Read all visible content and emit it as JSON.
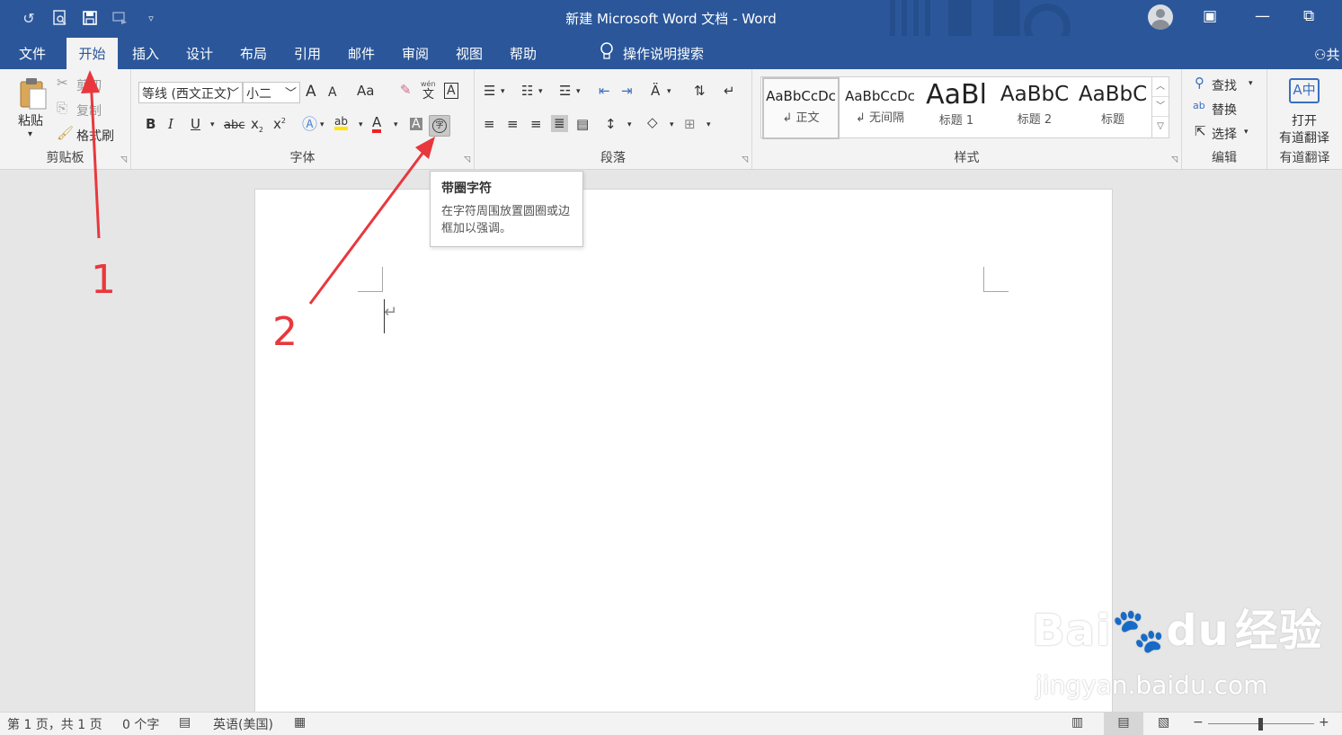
{
  "window": {
    "title": "新建 Microsoft Word 文档  -  Word"
  },
  "quick_access": {
    "icons": [
      "undo-icon",
      "print-preview-icon",
      "save-icon",
      "redo-icon",
      "customize-icon"
    ]
  },
  "tabs": [
    "文件",
    "开始",
    "插入",
    "设计",
    "布局",
    "引用",
    "邮件",
    "审阅",
    "视图",
    "帮助"
  ],
  "active_tab": "开始",
  "tell_me": "操作说明搜索",
  "share_label": "共",
  "clipboard": {
    "paste": "粘贴",
    "cut": "剪切",
    "copy": "复制",
    "format_painter": "格式刷",
    "label": "剪贴板"
  },
  "font": {
    "name": "等线 (西文正文)",
    "size": "小二",
    "label": "字体",
    "grow": "A",
    "shrink": "A",
    "case": "Aa",
    "bold": "B",
    "italic": "I",
    "underline": "U",
    "strike": "abc",
    "sub": "x",
    "sup": "x",
    "phonetic": "wén",
    "wen_char": "文",
    "border_char": "A",
    "font_color_char": "A",
    "shading_char": "A",
    "enclose_char": "字"
  },
  "paragraph": {
    "label": "段落"
  },
  "styles": {
    "label": "样式",
    "items": [
      {
        "preview": "AaBbCcDc",
        "name": "↲ 正文"
      },
      {
        "preview": "AaBbCcDc",
        "name": "↲ 无间隔"
      },
      {
        "preview": "AaBl",
        "name": "标题 1"
      },
      {
        "preview": "AaBbC",
        "name": "标题 2"
      },
      {
        "preview": "AaBbC",
        "name": "标题"
      }
    ]
  },
  "editing": {
    "find": "查找",
    "replace": "替换",
    "select": "选择",
    "label": "编辑"
  },
  "youdao": {
    "open": "打开",
    "translate": "有道翻译",
    "label": "有道翻译"
  },
  "tooltip": {
    "title": "带圈字符",
    "desc": "在字符周围放置圆圈或边框加以强调。"
  },
  "annotations": {
    "one": "1",
    "two": "2",
    "color": "#e8383d"
  },
  "status": {
    "page": "第 1 页，共 1 页",
    "words": "0 个字",
    "language": "英语(美国)"
  },
  "watermark": {
    "brand": "Bai",
    "brand2": "du",
    "jingyan": "经验",
    "url": "jingyan.baidu.com"
  },
  "colors": {
    "brand": "#2b579a",
    "ribbon": "#f3f3f3"
  }
}
